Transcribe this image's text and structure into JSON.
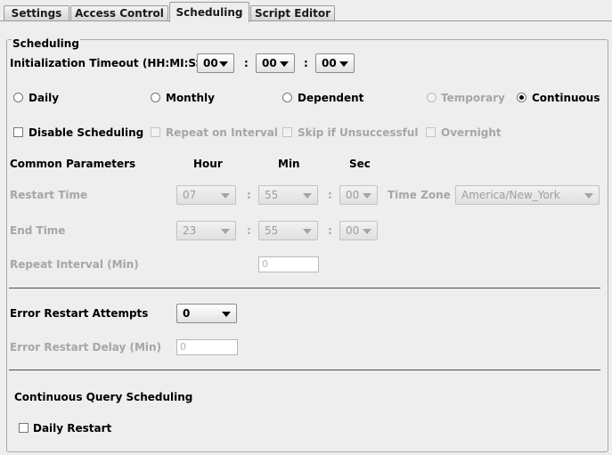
{
  "tabs": [
    {
      "label": "Settings"
    },
    {
      "label": "Access Control"
    },
    {
      "label": "Scheduling"
    },
    {
      "label": "Script Editor"
    }
  ],
  "panel_title": "Scheduling",
  "init_timeout": {
    "label": "Initialization Timeout (HH:MI:SS)",
    "hh": "00",
    "mm": "00",
    "ss": "00",
    "colon": ":"
  },
  "schedule_types": {
    "daily": "Daily",
    "monthly": "Monthly",
    "dependent": "Dependent",
    "temporary": "Temporary",
    "continuous": "Continuous",
    "selected": "Continuous"
  },
  "options": {
    "disable_scheduling": "Disable Scheduling",
    "repeat_on_interval": "Repeat on Interval",
    "skip_if_unsuccessful": "Skip if Unsuccessful",
    "overnight": "Overnight"
  },
  "common": {
    "title": "Common Parameters",
    "hour_header": "Hour",
    "min_header": "Min",
    "sec_header": "Sec",
    "restart_time": {
      "label": "Restart Time",
      "hour": "07",
      "min": "55",
      "sec": "00"
    },
    "time_zone": {
      "label": "Time Zone",
      "value": "America/New_York"
    },
    "end_time": {
      "label": "End Time",
      "hour": "23",
      "min": "55",
      "sec": "00"
    },
    "repeat_interval": {
      "label": "Repeat Interval (Min)",
      "value": "0"
    }
  },
  "errors": {
    "attempts_label": "Error Restart Attempts",
    "attempts_value": "0",
    "delay_label": "Error Restart Delay (Min)",
    "delay_value": "0"
  },
  "continuous": {
    "title": "Continuous Query Scheduling",
    "daily_restart": "Daily Restart"
  }
}
